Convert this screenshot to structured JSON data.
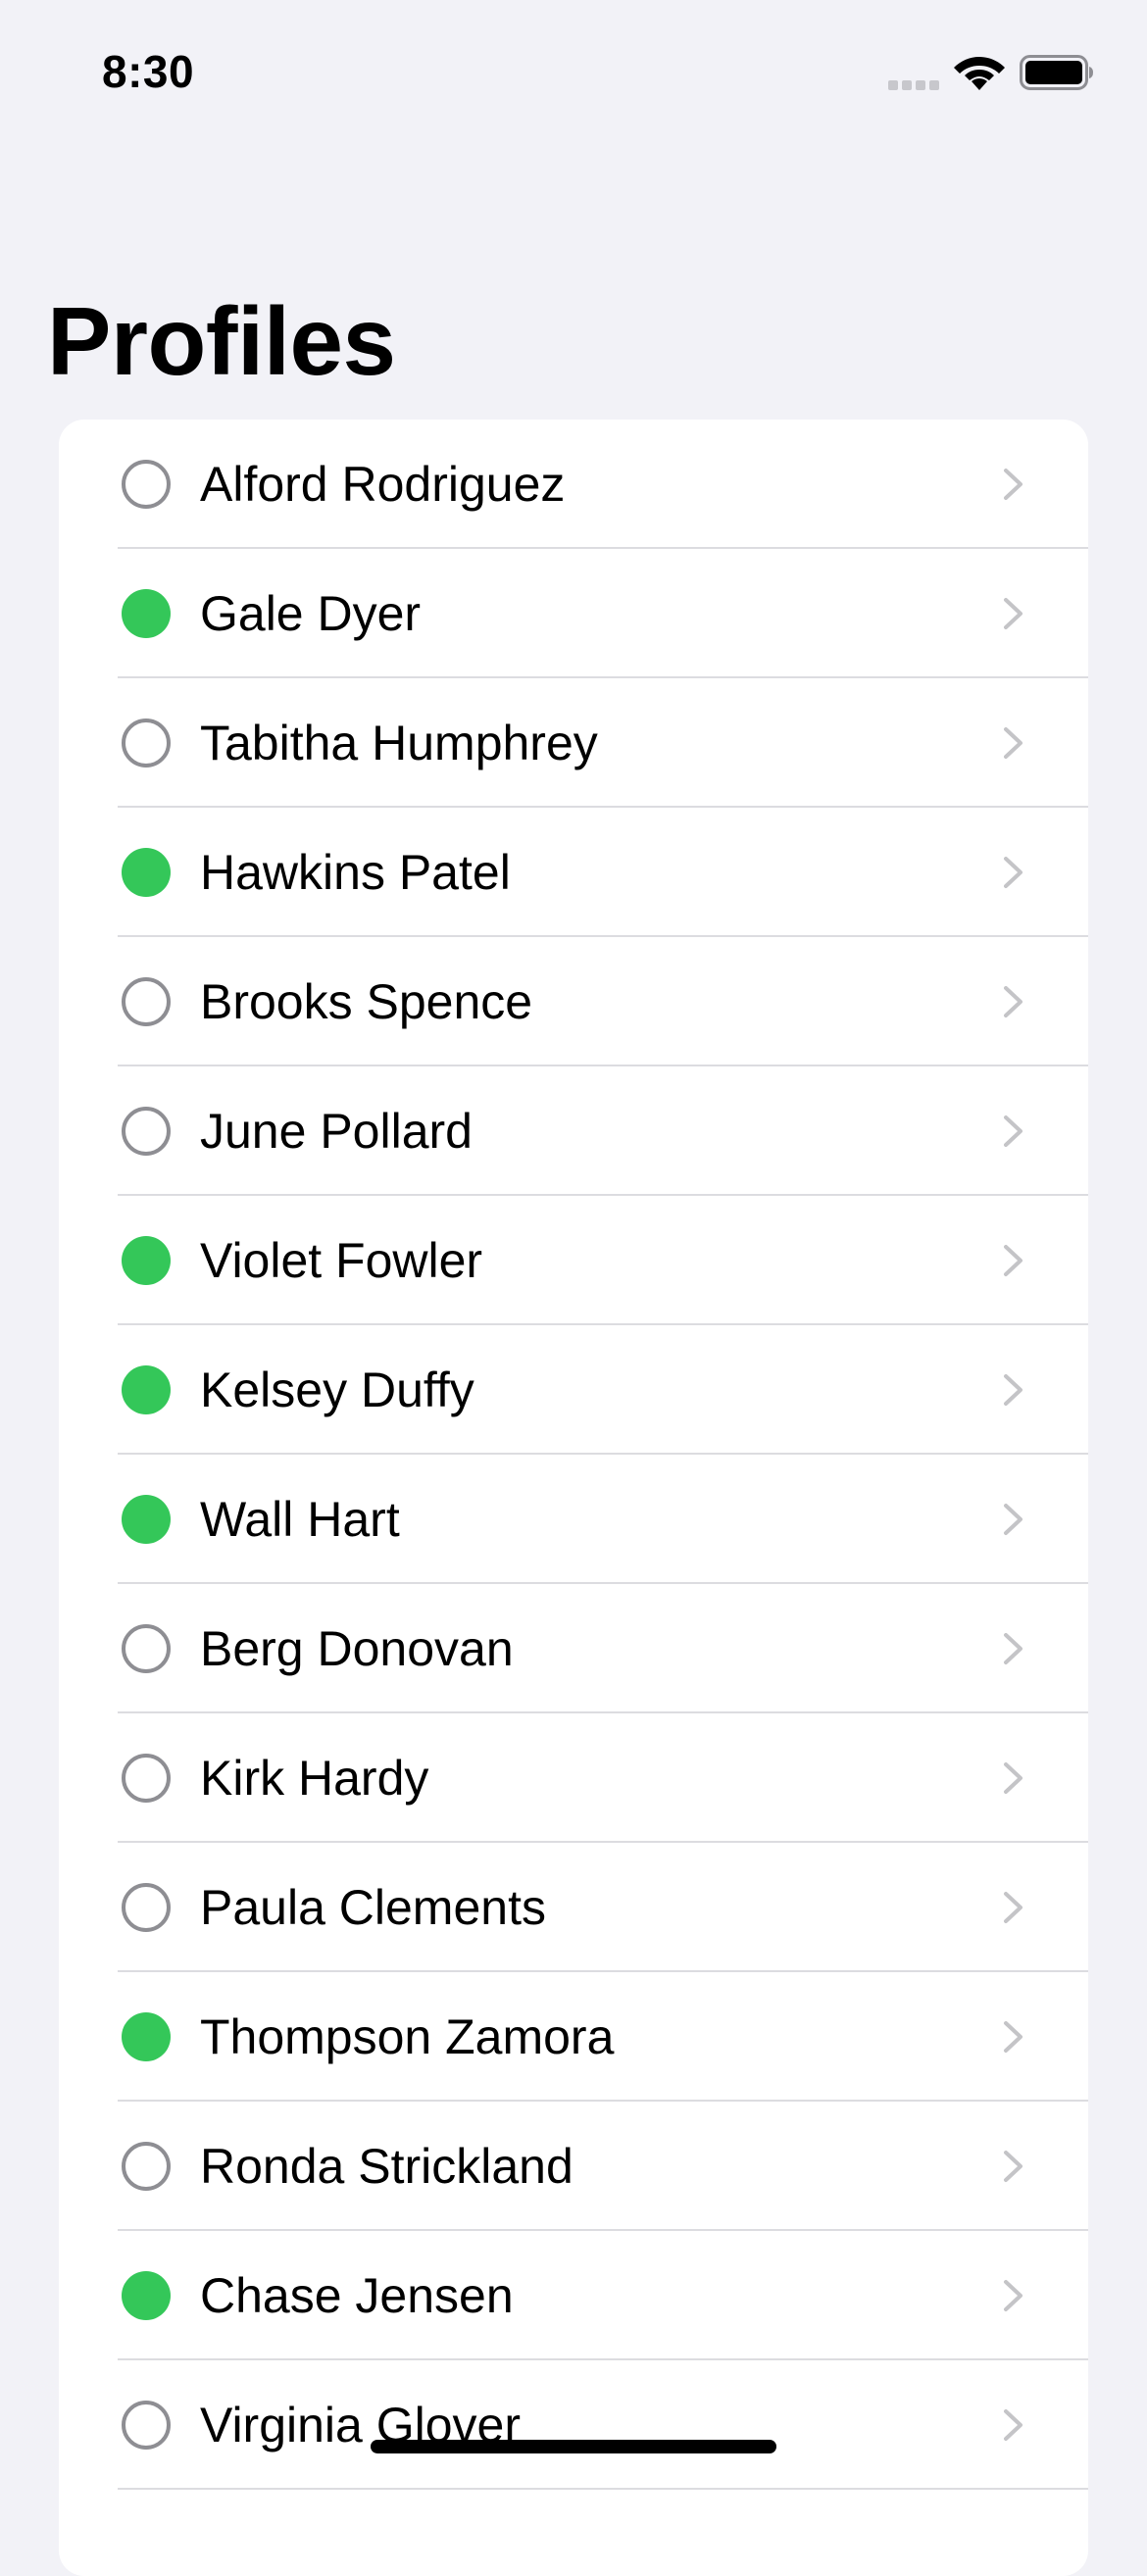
{
  "status_bar": {
    "time": "8:30"
  },
  "header": {
    "title": "Profiles"
  },
  "colors": {
    "background": "#f2f2f7",
    "card": "#ffffff",
    "online": "#34c759",
    "offline_ring": "#8e8e93",
    "chevron": "#c4c4c7"
  },
  "profiles": [
    {
      "name": "Alford Rodriguez",
      "online": false
    },
    {
      "name": "Gale Dyer",
      "online": true
    },
    {
      "name": "Tabitha Humphrey",
      "online": false
    },
    {
      "name": "Hawkins Patel",
      "online": true
    },
    {
      "name": "Brooks Spence",
      "online": false
    },
    {
      "name": "June Pollard",
      "online": false
    },
    {
      "name": "Violet Fowler",
      "online": true
    },
    {
      "name": "Kelsey Duffy",
      "online": true
    },
    {
      "name": "Wall Hart",
      "online": true
    },
    {
      "name": "Berg Donovan",
      "online": false
    },
    {
      "name": "Kirk Hardy",
      "online": false
    },
    {
      "name": "Paula Clements",
      "online": false
    },
    {
      "name": "Thompson Zamora",
      "online": true
    },
    {
      "name": "Ronda Strickland",
      "online": false
    },
    {
      "name": "Chase Jensen",
      "online": true
    },
    {
      "name": "Virginia Glover",
      "online": false
    }
  ]
}
